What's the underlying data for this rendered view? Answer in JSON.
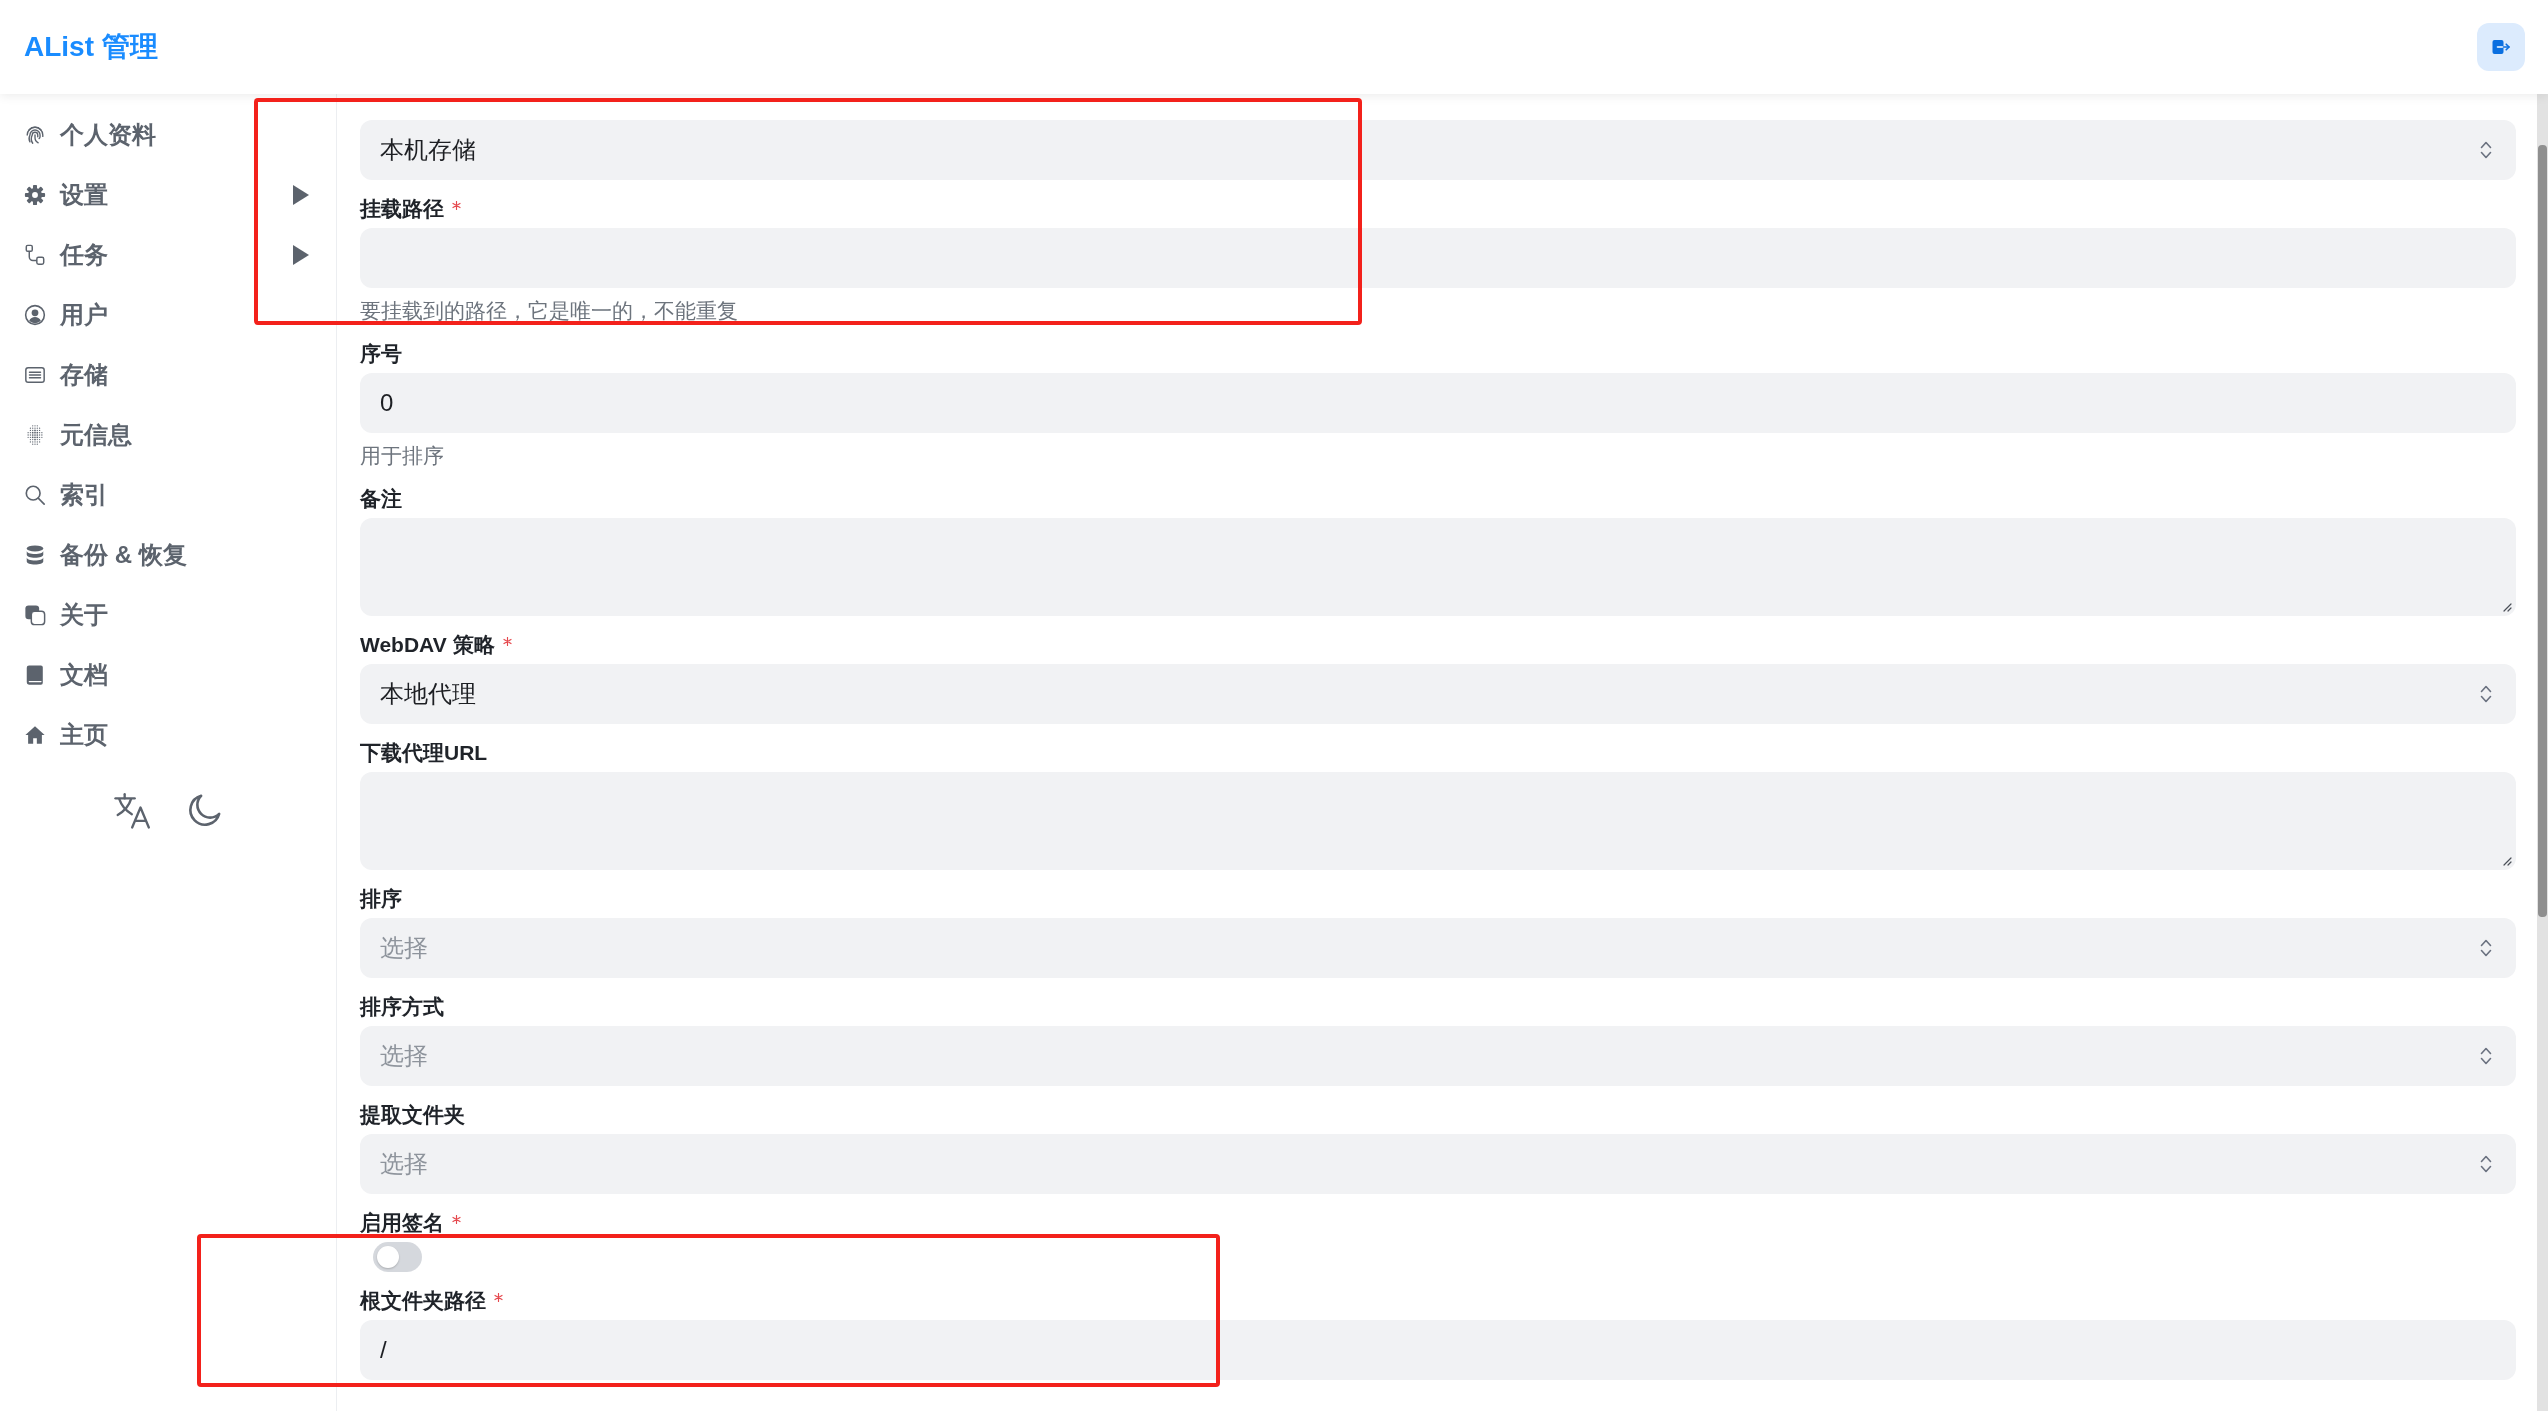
{
  "header": {
    "title": "AList 管理"
  },
  "sidebar": {
    "items": [
      {
        "label": "个人资料",
        "kind": "link"
      },
      {
        "label": "设置",
        "kind": "group",
        "expanded": false
      },
      {
        "label": "任务",
        "kind": "group",
        "expanded": false
      },
      {
        "label": "用户",
        "kind": "link"
      },
      {
        "label": "存储",
        "kind": "link"
      },
      {
        "label": "元信息",
        "kind": "link"
      },
      {
        "label": "索引",
        "kind": "link"
      },
      {
        "label": "备份 & 恢复",
        "kind": "link"
      },
      {
        "label": "关于",
        "kind": "link"
      },
      {
        "label": "文档",
        "kind": "link"
      },
      {
        "label": "主页",
        "kind": "link"
      }
    ]
  },
  "form": {
    "fields": [
      {
        "kind": "select",
        "value": "本机存储"
      },
      {
        "kind": "input",
        "label": "挂载路径",
        "required": true,
        "hint": "要挂载到的路径，它是唯一的，不能重复"
      },
      {
        "kind": "input",
        "label": "序号",
        "required": false,
        "value": "0",
        "hint": "用于排序"
      },
      {
        "kind": "textarea",
        "label": "备注",
        "required": false
      },
      {
        "kind": "select",
        "label": "WebDAV 策略",
        "required": true,
        "value": "本地代理"
      },
      {
        "kind": "textarea",
        "label": "下载代理URL",
        "required": false
      },
      {
        "kind": "select",
        "label": "排序",
        "required": false,
        "placeholder": "选择"
      },
      {
        "kind": "select",
        "label": "排序方式",
        "required": false,
        "placeholder": "选择"
      },
      {
        "kind": "select",
        "label": "提取文件夹",
        "required": false,
        "placeholder": "选择"
      },
      {
        "kind": "switch",
        "label": "启用签名",
        "required": true,
        "on": false
      },
      {
        "kind": "input",
        "label": "根文件夹路径",
        "required": true,
        "value": "/"
      }
    ]
  },
  "annotations": [
    {
      "kind": "rectangle"
    },
    {
      "kind": "rectangle"
    }
  ]
}
